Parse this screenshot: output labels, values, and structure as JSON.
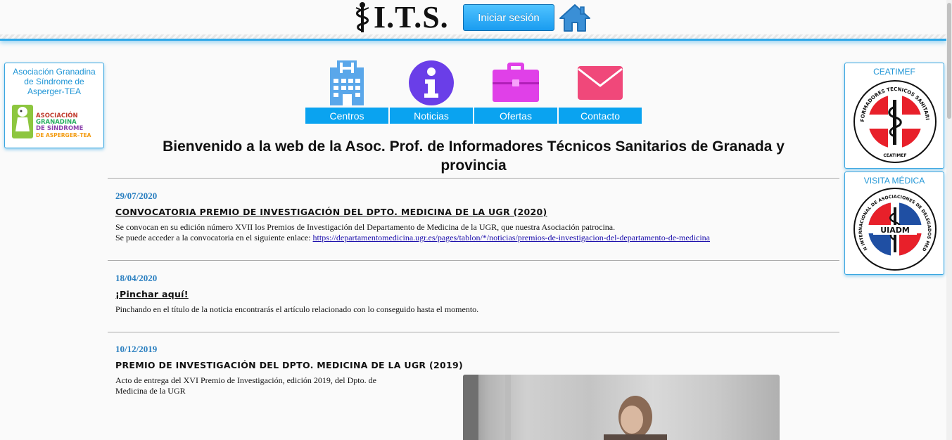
{
  "header": {
    "logo_text": "I.T.S.",
    "login_label": "Iniciar sesión"
  },
  "left_sidebar": {
    "title": "Asociación Granadina de Síndrome de Asperger-TEA",
    "logo_lines": [
      "ASOCIACIÓN",
      "GRANADINA",
      "DE SÍNDROME",
      "DE ASPERGER–TEA"
    ]
  },
  "right_sidebar": {
    "box1_title": "CEATIMEF",
    "box1_logo_ring": "INFORMADORES TECNICOS SANITARIOS",
    "box1_logo_bottom": "CEATIMEF",
    "box2_title": "VISITA MÉDICA",
    "box2_logo_ring": "UNION INTERNACIONAL DE ASOCIACIONES DE DELEGADOS MEDICOS",
    "box2_logo_text": "UIADM"
  },
  "nav": [
    {
      "label": "Centros",
      "icon": "hospital-icon"
    },
    {
      "label": "Noticias",
      "icon": "info-icon"
    },
    {
      "label": "Ofertas",
      "icon": "briefcase-icon"
    },
    {
      "label": "Contacto",
      "icon": "envelope-icon"
    }
  ],
  "welcome": "Bienvenido a la web de la Asoc. Prof. de Informadores Técnicos Sanitarios de Granada y provincia",
  "news": [
    {
      "date": "29/07/2020",
      "title": "CONVOCATORIA PREMIO DE INVESTIGACIÓN DEL DPTO. MEDICINA DE LA UGR (2020)",
      "body_line1": "Se convocan en su edición número XVII los Premios de Investigación del Departamento de Medicina de la UGR, que nuestra Asociación patrocina.",
      "body_line2_prefix": "Se puede acceder a la convocatoria en el siguiente enlace: ",
      "link": "https://departamentomedicina.ugr.es/pages/tablon/*/noticias/premios-de-investigacion-del-departamento-de-medicina"
    },
    {
      "date": "18/04/2020",
      "title": "¡Pinchar aquí!",
      "body_line1": "Pinchando en el título de la noticia encontrarás el artículo relacionado con lo conseguido hasta el momento."
    },
    {
      "date": "10/12/2019",
      "title": "PREMIO DE INVESTIGACIÓN DEL DPTO. MEDICINA DE LA UGR (2019)",
      "body_line1": "Acto de entrega del XVI Premio de Investigación, edición 2019, del Dpto. de",
      "body_line2": "Medicina de la UGR"
    }
  ],
  "colors": {
    "accent": "#0aa3f0",
    "link": "#1a0dab",
    "date": "#2a7fc0"
  }
}
